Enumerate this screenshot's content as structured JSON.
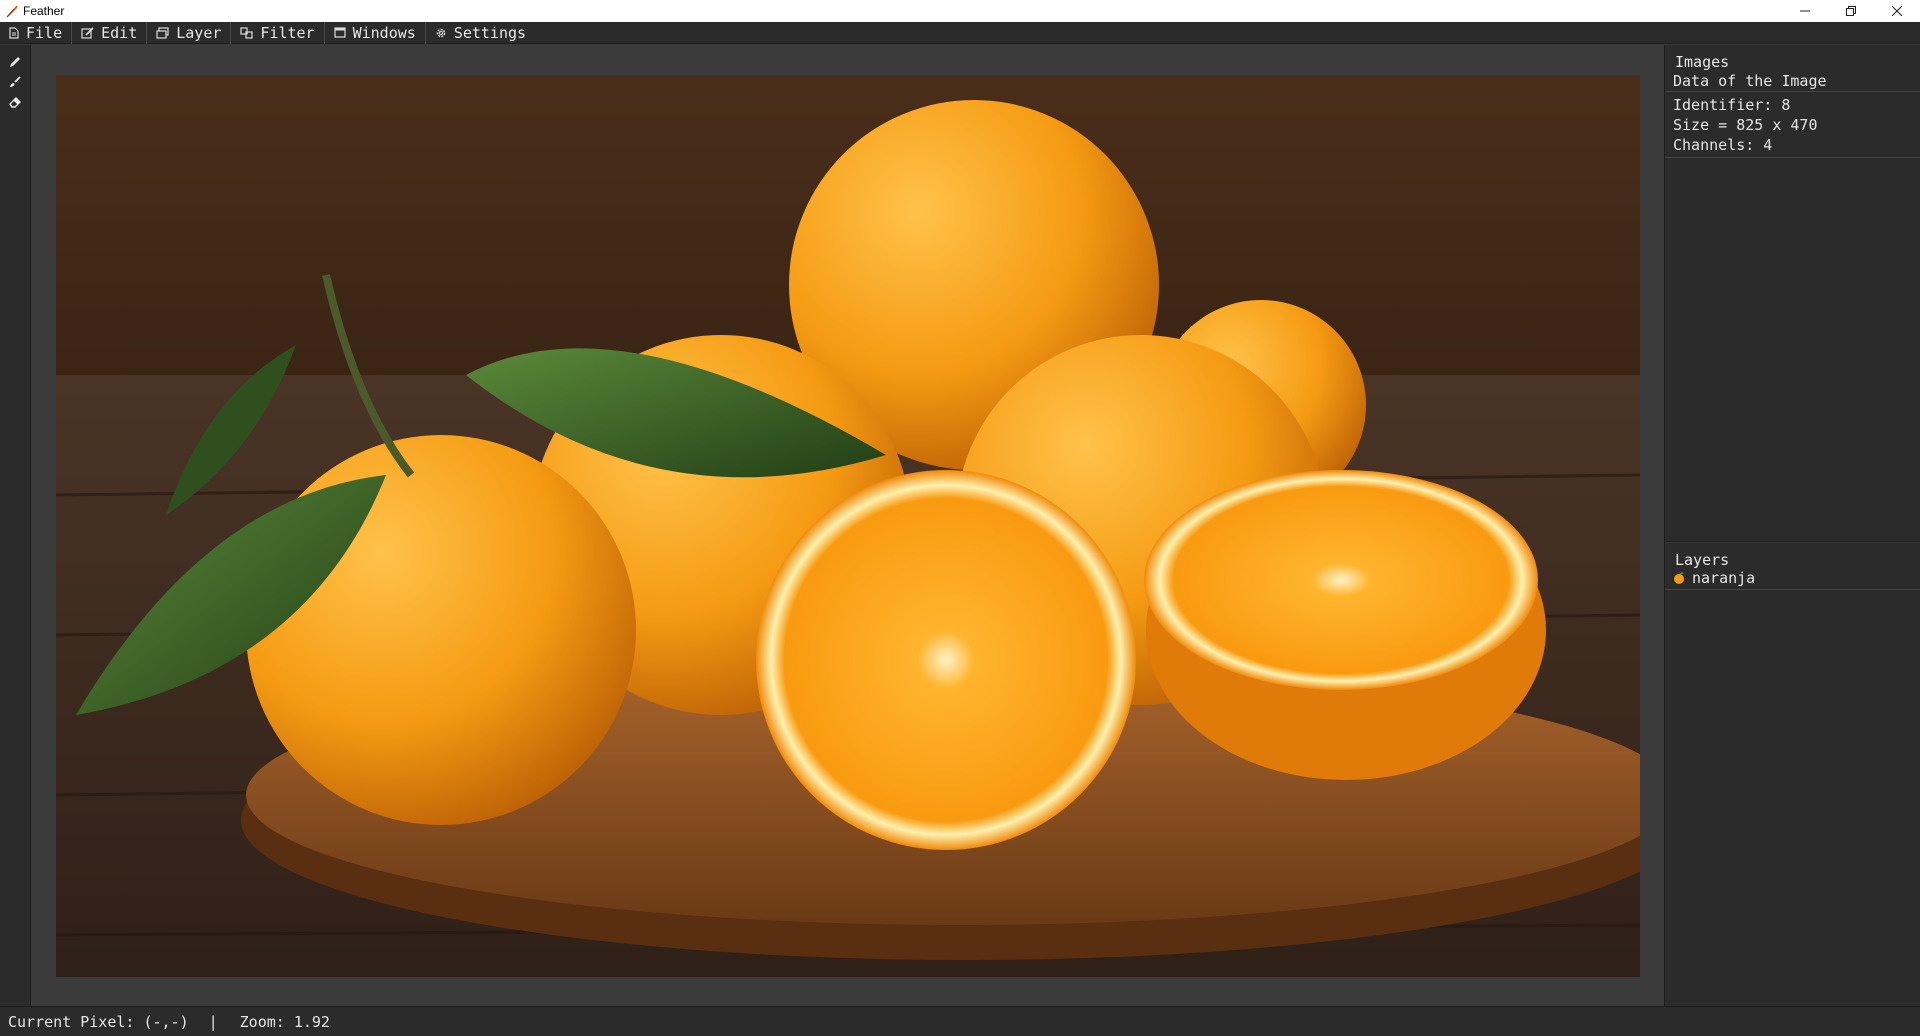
{
  "window": {
    "title": "Feather",
    "icons": {
      "app": "feather-icon",
      "minimize": "minimize-icon",
      "restore": "restore-icon",
      "close": "close-icon"
    }
  },
  "menu": {
    "items": [
      {
        "label": "File",
        "icon": "file-icon"
      },
      {
        "label": "Edit",
        "icon": "edit-icon"
      },
      {
        "label": "Layer",
        "icon": "layer-icon"
      },
      {
        "label": "Filter",
        "icon": "filter-icon"
      },
      {
        "label": "Windows",
        "icon": "window-icon"
      },
      {
        "label": "Settings",
        "icon": "gear-icon"
      }
    ]
  },
  "tools": [
    {
      "name": "pencil-tool",
      "icon": "pencil-icon"
    },
    {
      "name": "brush-tool",
      "icon": "brush-icon"
    },
    {
      "name": "eraser-tool",
      "icon": "eraser-icon"
    }
  ],
  "images_panel": {
    "title": "Images",
    "subtitle": "Data of the Image",
    "identifier": "Identifier: 8",
    "size": "Size = 825 x 470",
    "channels": "Channels: 4"
  },
  "layers_panel": {
    "title": "Layers",
    "layers": [
      {
        "name": "naranja",
        "icon": "orange-layer-icon"
      }
    ]
  },
  "status": {
    "pixel": "Current Pixel: (-,-)",
    "separator": "|",
    "zoom": "Zoom: 1.92"
  },
  "colors": {
    "background": "#3b3b3b",
    "panel": "#2b2b2b",
    "text": "#e6e6e6",
    "orange": "#f59a12",
    "leaf": "#3f6b2a"
  }
}
